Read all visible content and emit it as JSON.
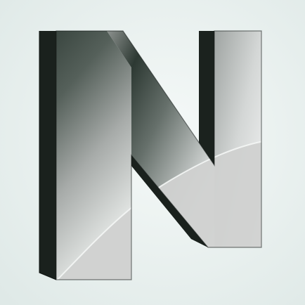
{
  "logo": {
    "letter": "N",
    "name": "n-letter-logo-icon"
  },
  "colors": {
    "background_light": "#f3f8f7",
    "background_mid": "#e4edeb",
    "side_dark": "#1d2520",
    "face_dark": "#2a3731",
    "face_light": "#e8ebea",
    "highlight": "#cfd0cf"
  }
}
